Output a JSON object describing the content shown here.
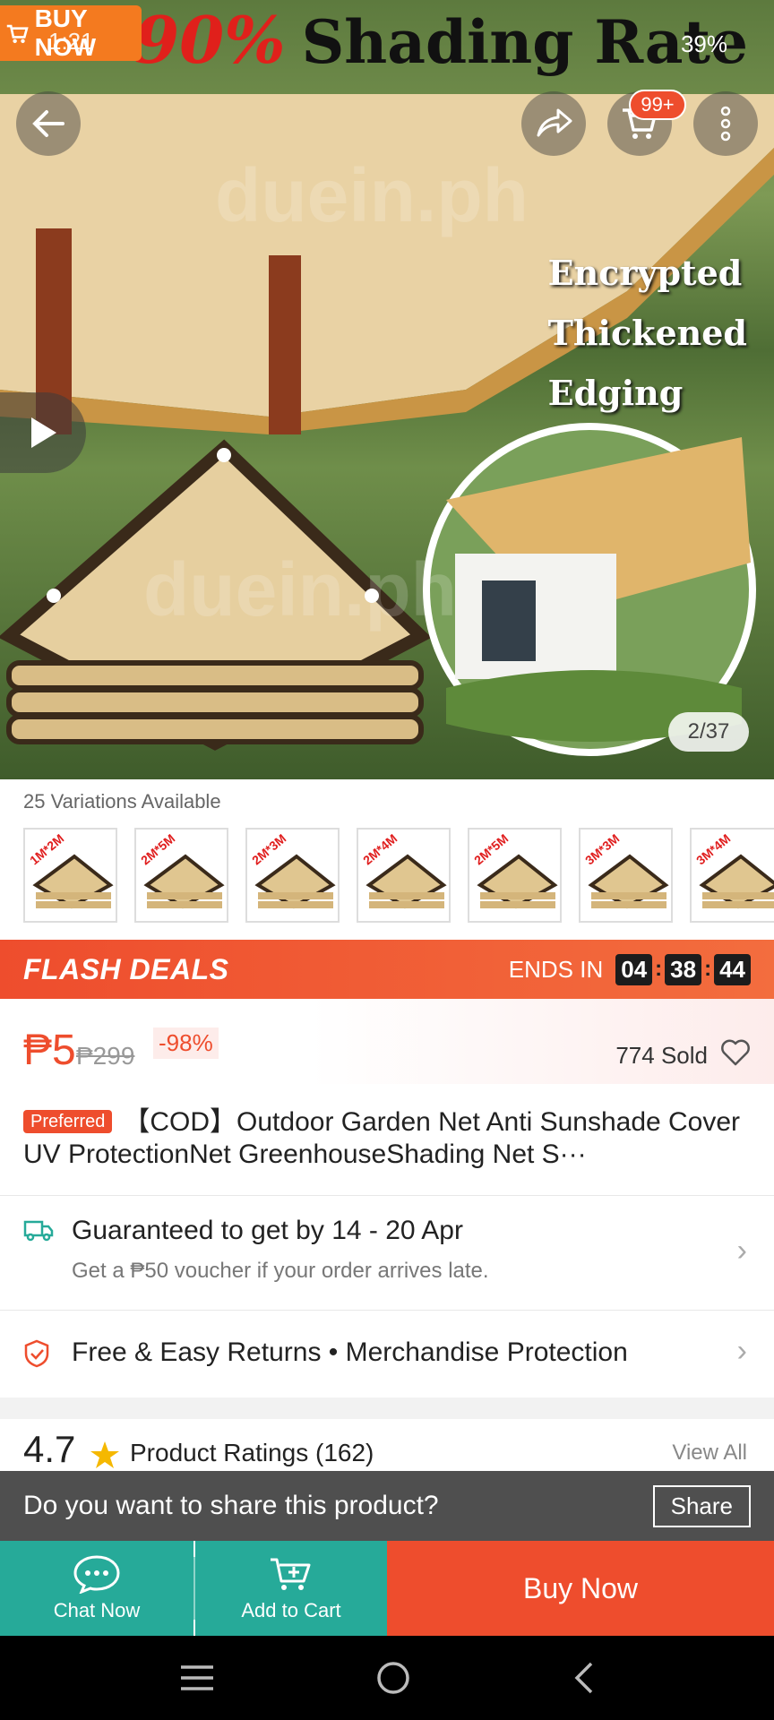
{
  "status_bar": {
    "time": "1:21",
    "battery": "39%"
  },
  "hero": {
    "badge_text": "BUY NOW",
    "headline_pct": "90%",
    "headline_text": "Shading Rate",
    "features": [
      "Encrypted",
      "Thickened",
      "Edging"
    ],
    "watermark": "duein.ph",
    "cart_count": "99+",
    "image_counter": "2/37"
  },
  "variations": {
    "label": "25 Variations Available",
    "items": [
      "1M*2M",
      "2M*5M",
      "2M*3M",
      "2M*4M",
      "2M*5M",
      "3M*3M",
      "3M*4M"
    ]
  },
  "flash_deals": {
    "title": "FLASH DEALS",
    "ends_in": "ENDS IN",
    "hours": "04",
    "minutes": "38",
    "seconds": "44"
  },
  "price": {
    "current": "₱5",
    "original": "₱299",
    "discount": "-98%",
    "sold": "774 Sold"
  },
  "product": {
    "badge": "Preferred",
    "title": "【COD】Outdoor Garden Net Anti  Sunshade Cover UV ProtectionNet GreenhouseShading   Net S···"
  },
  "guarantee": {
    "title": "Guaranteed to get by 14 - 20 Apr",
    "subtitle": "Get a ₱50 voucher if your order arrives late."
  },
  "returns": {
    "text": "Free & Easy Returns  •  Merchandise Protection"
  },
  "ratings": {
    "value": "4.7",
    "label": "Product Ratings (162)",
    "view_all": "View All"
  },
  "share_toast": {
    "question": "Do you want to share this product?",
    "button": "Share"
  },
  "bottom_bar": {
    "chat": "Chat Now",
    "cart": "Add to Cart",
    "buy": "Buy Now"
  },
  "colors": {
    "brand": "#ee4d2d",
    "teal": "#26aa99"
  }
}
